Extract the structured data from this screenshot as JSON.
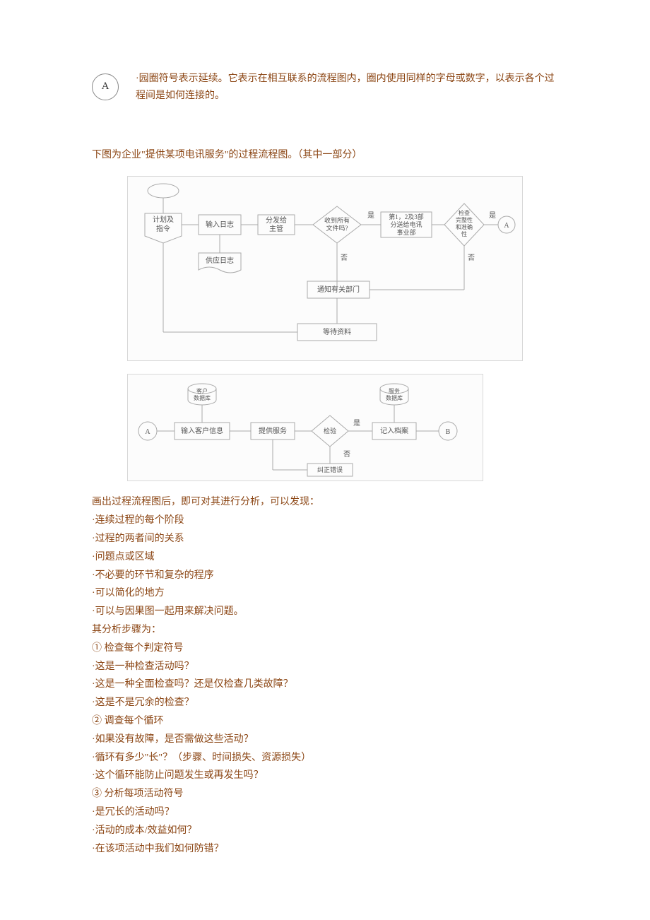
{
  "intro": {
    "circle_label": "A",
    "text": "·园圈符号表示延续。它表示在相互联系的流程图内，圈内使用同样的字母或数字，以表示各个过程间是如何连接的。"
  },
  "caption": "下图为企业\"提供某项电讯服务\"的过程流程图。（其中一部分）",
  "flow1": {
    "b1": [
      "计划及",
      "指令"
    ],
    "b2": "输入日志",
    "b3": [
      "分发给",
      "主管"
    ],
    "d1": [
      "收到所有",
      "文件吗?"
    ],
    "b4": [
      "第1，2及3部",
      "分送给电讯",
      "事业部"
    ],
    "d2": [
      "检查",
      "完整性",
      "和准确",
      "性"
    ],
    "conn": "A",
    "doc": "供应日志",
    "b5": "通知有关部门",
    "b6": "等待资料",
    "yes": "是",
    "no": "否"
  },
  "flow2": {
    "conn_a": "A",
    "b1": "输入客户信息",
    "b2": "提供服务",
    "d1": "检验",
    "b3": "记入档案",
    "conn_b": "B",
    "db1": [
      "客户",
      "数据库"
    ],
    "db2": [
      "服务",
      "数据库"
    ],
    "b4": "纠正错误",
    "yes": "是",
    "no": "否"
  },
  "analysis": {
    "p1": "画出过程流程图后，即可对其进行分析，可以发现：",
    "p2": "·连续过程的每个阶段",
    "p3": "·过程的两者间的关系",
    "p4": "·问题点或区域",
    "p5": "·不必要的环节和复杂的程序",
    "p6": "·可以简化的地方",
    "p7": "·可以与因果图一起用来解决问题。",
    "p8": "其分析步骤为：",
    "p9": "① 检查每个判定符号",
    "p10": "·这是一种检查活动吗？",
    "p11": "·这是一种全面检查吗？还是仅检查几类故障？",
    "p12": "·这是不是冗余的检查？",
    "p13": "② 调查每个循环",
    "p14": "·如果没有故障，是否需做这些活动？",
    "p15": "·循环有多少\"长\"？（步骤、时间损失、资源损失）",
    "p16": "·这个循环能防止问题发生或再发生吗？",
    "p17": "③ 分析每项活动符号",
    "p18": "·是冗长的活动吗？",
    "p19": "·活动的成本/效益如何？",
    "p20": "·在该项活动中我们如何防错？"
  }
}
